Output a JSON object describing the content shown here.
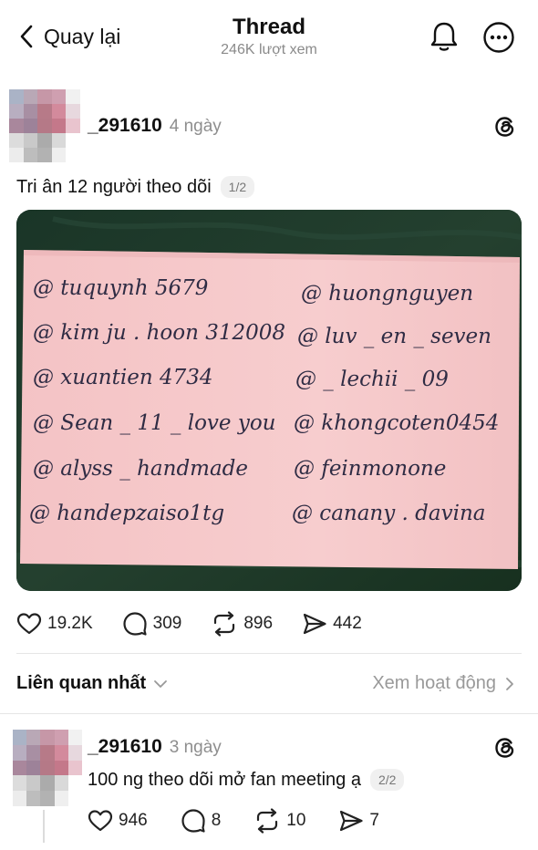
{
  "header": {
    "back_label": "Quay lại",
    "title": "Thread",
    "views": "246K lượt xem"
  },
  "post": {
    "username": "_291610",
    "time": "4 ngày",
    "text": "Tri ân 12 người theo dõi",
    "page": "1/2",
    "image_handwriting": {
      "left": [
        "@ tuquynh 5679",
        "@ kim ju . hoon 312008",
        "@ xuantien 4734",
        "@ Sean _ 11 _ love you",
        "@ alyss _ handmade",
        "@ handepzaiso1tg"
      ],
      "right": [
        "@ huongnguyen",
        "@ luv _ en _ seven",
        "@ _ lechii _ 09",
        "@ khongcoten0454",
        "@ feinmonone",
        "@ canany . davina"
      ]
    },
    "likes": "19.2K",
    "replies": "309",
    "reposts": "896",
    "shares": "442"
  },
  "sort": {
    "label": "Liên quan nhất",
    "activity_label": "Xem hoạt động"
  },
  "reply": {
    "username": "_291610",
    "time": "3 ngày",
    "text": "100 ng theo dõi mở fan meeting ạ",
    "page": "2/2",
    "likes": "946",
    "replies": "8",
    "reposts": "10",
    "shares": "7"
  },
  "colors": {
    "paper": "#f6c6c8",
    "background_fabric": "#1f3a2c",
    "ink": "#2a2a3a"
  },
  "icons": [
    "chevron-left-icon",
    "bell-icon",
    "more-icon",
    "threads-logo-icon",
    "heart-icon",
    "comment-icon",
    "repost-icon",
    "share-icon",
    "chevron-down-icon",
    "chevron-right-icon"
  ]
}
